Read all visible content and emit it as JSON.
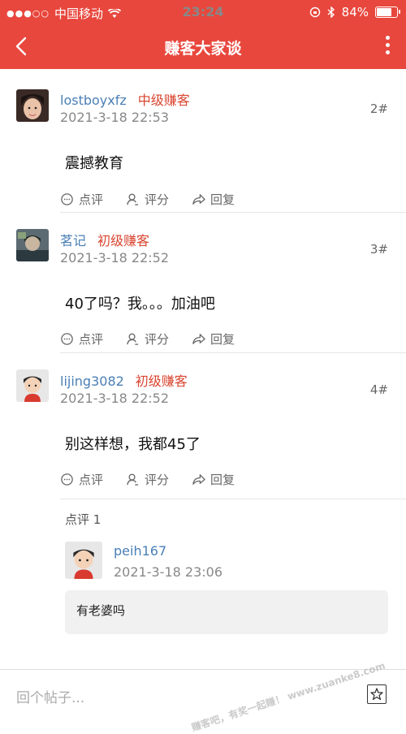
{
  "status_bar": {
    "carrier": "中国移动",
    "time": "23:24",
    "battery": "84%",
    "battery_level": 0.84
  },
  "nav": {
    "title": "赚客大家谈"
  },
  "posts": [
    {
      "username": "lostboyxfz",
      "rank": "中级赚客",
      "time": "2021-3-18 22:53",
      "floor": "2#",
      "content": "震撼教育",
      "actions": {
        "comment": "点评",
        "rate": "评分",
        "reply": "回复"
      }
    },
    {
      "username": "茗记",
      "rank": "初级赚客",
      "time": "2021-3-18 22:52",
      "floor": "3#",
      "content": "40了吗？我。。。加油吧",
      "actions": {
        "comment": "点评",
        "rate": "评分",
        "reply": "回复"
      }
    },
    {
      "username": "lijing3082",
      "rank": "初级赚客",
      "time": "2021-3-18 22:52",
      "floor": "4#",
      "content": "别这样想，我都45了",
      "actions": {
        "comment": "点评",
        "rate": "评分",
        "reply": "回复"
      }
    }
  ],
  "comments": {
    "header": "点评 1",
    "items": [
      {
        "username": "peih167",
        "time": "2021-3-18 23:06",
        "body": "有老婆吗"
      }
    ]
  },
  "bottom_bar": {
    "placeholder": "回个帖子..."
  },
  "watermark": "赚客吧，有奖一起赚！ www.zuanke8.com",
  "colors": {
    "accent": "#e8473d",
    "username": "#4a7fb5",
    "rank": "#d9442f"
  },
  "icons": [
    "back-icon",
    "more-icon",
    "wifi-icon",
    "bluetooth-icon",
    "lock-rotation-icon",
    "comment-icon",
    "rate-icon",
    "reply-icon",
    "favorite-icon"
  ]
}
